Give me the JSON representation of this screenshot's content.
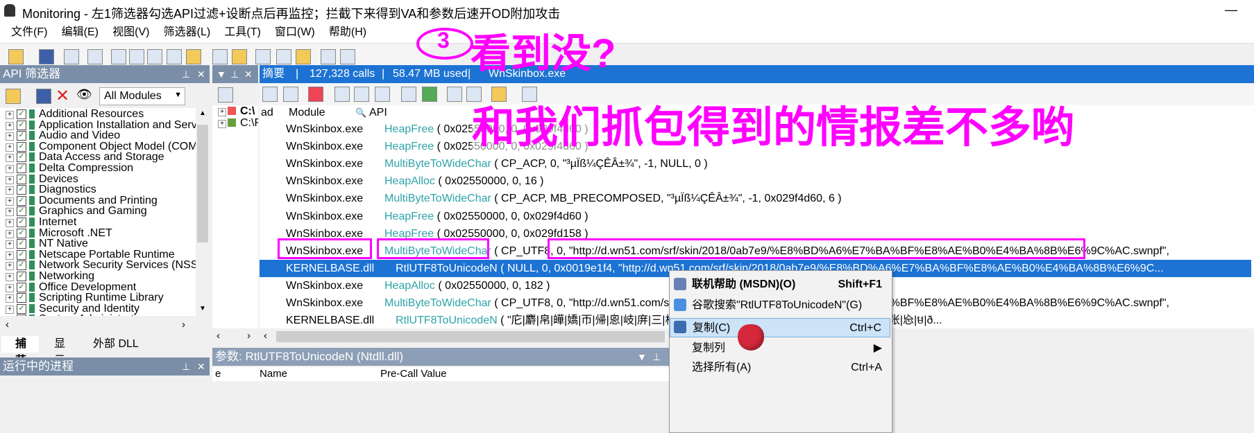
{
  "window": {
    "title": "Monitoring - 左1筛选器勾选API过滤+设断点后再监控；拦截下来得到VA和参数后速开OD附加攻击",
    "minimize_glyph": "—"
  },
  "menu": [
    "文件(F)",
    "编辑(E)",
    "视图(V)",
    "筛选器(L)",
    "工具(T)",
    "窗口(W)",
    "帮助(H)"
  ],
  "api_filter": {
    "title": "API 筛选器",
    "module_select": "All Modules",
    "categories": [
      "Additional Resources",
      "Application Installation and Servici",
      "Audio and Video",
      "Component Object Model (COM)",
      "Data Access and Storage",
      "Delta Compression",
      "Devices",
      "Diagnostics",
      "Documents and Printing",
      "Graphics and Gaming",
      "Internet",
      "Microsoft .NET",
      "NT Native",
      "Netscape Portable Runtime",
      "Network Security Services (NSS)",
      "Networking",
      "Office Development",
      "Scripting Runtime Library",
      "Security and Identity",
      "System Administration"
    ],
    "tabs": [
      "捕获",
      "显示",
      "外部 DLL"
    ]
  },
  "process_tree": {
    "items": [
      "C:\\",
      "C:\\F"
    ]
  },
  "summary": {
    "label": "摘要",
    "calls": "127,328 calls",
    "memory": "58.47 MB used",
    "process": "WnSkinbox.exe"
  },
  "grid": {
    "columns": [
      "ad",
      "Module",
      "API"
    ],
    "rows": [
      {
        "module": "WnSkinbox.exe",
        "fn": "HeapFree",
        "args": "( 0x02550000, 0, 0x029f4d60 )",
        "indent": 0,
        "selected": false
      },
      {
        "module": "WnSkinbox.exe",
        "fn": "HeapFree",
        "args": "( 0x02550000, 0, 0x029f4d60 )",
        "indent": 0,
        "selected": false
      },
      {
        "module": "WnSkinbox.exe",
        "fn": "MultiByteToWideChar",
        "args": "( CP_ACP, 0, \"³µÏß¼ÇÊÂ±¾\", -1, NULL, 0 )",
        "indent": 0,
        "selected": false
      },
      {
        "module": "WnSkinbox.exe",
        "fn": "HeapAlloc",
        "args": "( 0x02550000, 0, 16 )",
        "indent": 0,
        "selected": false
      },
      {
        "module": "WnSkinbox.exe",
        "fn": "MultiByteToWideChar",
        "args": "( CP_ACP, MB_PRECOMPOSED, \"³µÏß¼ÇÊÂ±¾\", -1, 0x029f4d60, 6 )",
        "indent": 0,
        "selected": false
      },
      {
        "module": "WnSkinbox.exe",
        "fn": "HeapFree",
        "args": "( 0x02550000, 0, 0x029f4d60 )",
        "indent": 0,
        "selected": false
      },
      {
        "module": "WnSkinbox.exe",
        "fn": "HeapFree",
        "args": "( 0x02550000, 0, 0x029fd158 )",
        "indent": 0,
        "selected": false
      },
      {
        "module": "WnSkinbox.exe",
        "fn": "MultiByteToWideChar",
        "args": "( CP_UTF8, 0, \"http://d.wn51.com/srf/skin/2018/0ab7e9/%E8%BD%A6%E7%BA%BF%E8%AE%B0%E4%BA%8B%E6%9C%AC.swnpf\",",
        "indent": 0,
        "selected": false
      },
      {
        "module": "KERNELBASE.dll",
        "fn": "RtlUTF8ToUnicodeN",
        "args": "( NULL, 0, 0x0019e1f4, \"http://d.wn51.com/srf/skin/2018/0ab7e9/%E8%BD%A6%E7%BA%BF%E8%AE%B0%E4%BA%8B%E6%9C...",
        "indent": 1,
        "selected": true
      },
      {
        "module": "WnSkinbox.exe",
        "fn": "HeapAlloc",
        "args": "( 0x02550000, 0, 182 )",
        "indent": 0,
        "selected": false
      },
      {
        "module": "WnSkinbox.exe",
        "fn": "MultiByteToWideChar",
        "args": "( CP_UTF8, 0, \"http://d.wn51.com/srf/skin/2018/0ab7e9/%E8%BD%A6%E7%BA%BF%E8%AE%B0%E4%BA%8B%E6%9C%AC.swnpf\",",
        "indent": 0,
        "selected": false
      },
      {
        "module": "KERNELBASE.dll",
        "fn": "RtlUTF8ToUnicodeN",
        "args": "( \"庀|麝|帛|皣|嬌|帀|帰|恖|岐|庰|三|桜|帛|帀|恖|帰|庀|嬌|開|忎|庐|慶|弐|庠|厩|忠|廳|张|㤀|ម|ð...",
        "indent": 1,
        "selected": false
      }
    ]
  },
  "annotations": {
    "step_number": "3",
    "see_it": "看到没?",
    "same_as_capture": "和我们抓包得到的情报差不多哟"
  },
  "context_menu": [
    {
      "label": "联机帮助 (MSDN)(O)",
      "shortcut": "Shift+F1",
      "bold": true
    },
    {
      "label": "谷歌搜索\"RtlUTF8ToUnicodeN\"(G)",
      "shortcut": ""
    },
    {
      "label": "复制(C)",
      "shortcut": "Ctrl+C",
      "active": true
    },
    {
      "label": "复制列",
      "shortcut": "▶"
    },
    {
      "label": "选择所有(A)",
      "shortcut": "Ctrl+A"
    }
  ],
  "running_processes": {
    "title": "运行中的进程"
  },
  "params_panel": {
    "title": "参数: RtlUTF8ToUnicodeN (Ntdll.dll)",
    "columns": [
      "e",
      "Name",
      "Pre-Call Value"
    ]
  },
  "colors": {
    "selected_row": "#1c73d3",
    "annotation": "#ff00ff",
    "api_name": "#2ea3a8",
    "arg_value": "#8b1a1a"
  }
}
